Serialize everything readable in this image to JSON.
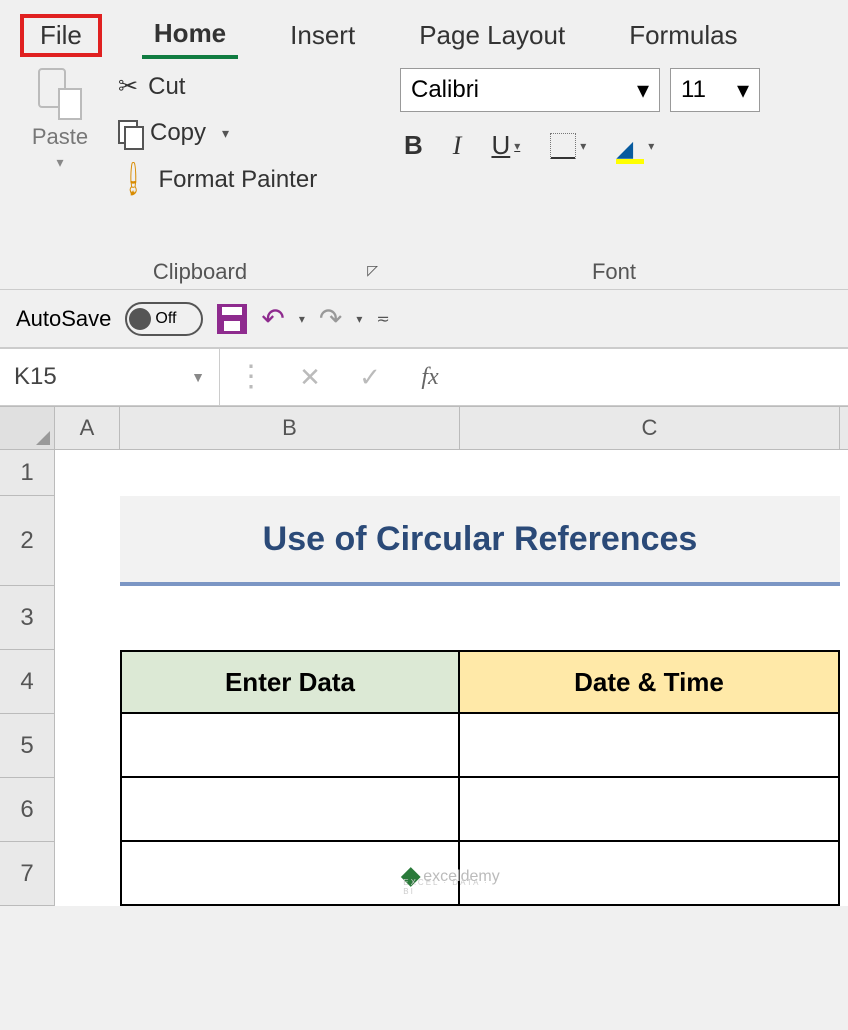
{
  "tabs": {
    "file": "File",
    "home": "Home",
    "insert": "Insert",
    "page_layout": "Page Layout",
    "formulas": "Formulas"
  },
  "clipboard": {
    "paste": "Paste",
    "cut": "Cut",
    "copy": "Copy",
    "format_painter": "Format Painter",
    "group_label": "Clipboard"
  },
  "font": {
    "name": "Calibri",
    "size": "11",
    "group_label": "Font"
  },
  "qat": {
    "autosave": "AutoSave",
    "toggle": "Off"
  },
  "namebox": "K15",
  "fx_label": "fx",
  "formula": "",
  "columns": {
    "a": "A",
    "b": "B",
    "c": "C"
  },
  "row_labels": [
    "1",
    "2",
    "3",
    "4",
    "5",
    "6",
    "7"
  ],
  "sheet": {
    "title": "Use of Circular References",
    "headers": {
      "b": "Enter Data",
      "c": "Date & Time"
    },
    "rows": [
      {
        "b": "",
        "c": ""
      },
      {
        "b": "",
        "c": ""
      },
      {
        "b": "",
        "c": ""
      }
    ]
  },
  "watermark": {
    "text": "exceldemy",
    "sub": "EXCEL · DATA · BI"
  }
}
